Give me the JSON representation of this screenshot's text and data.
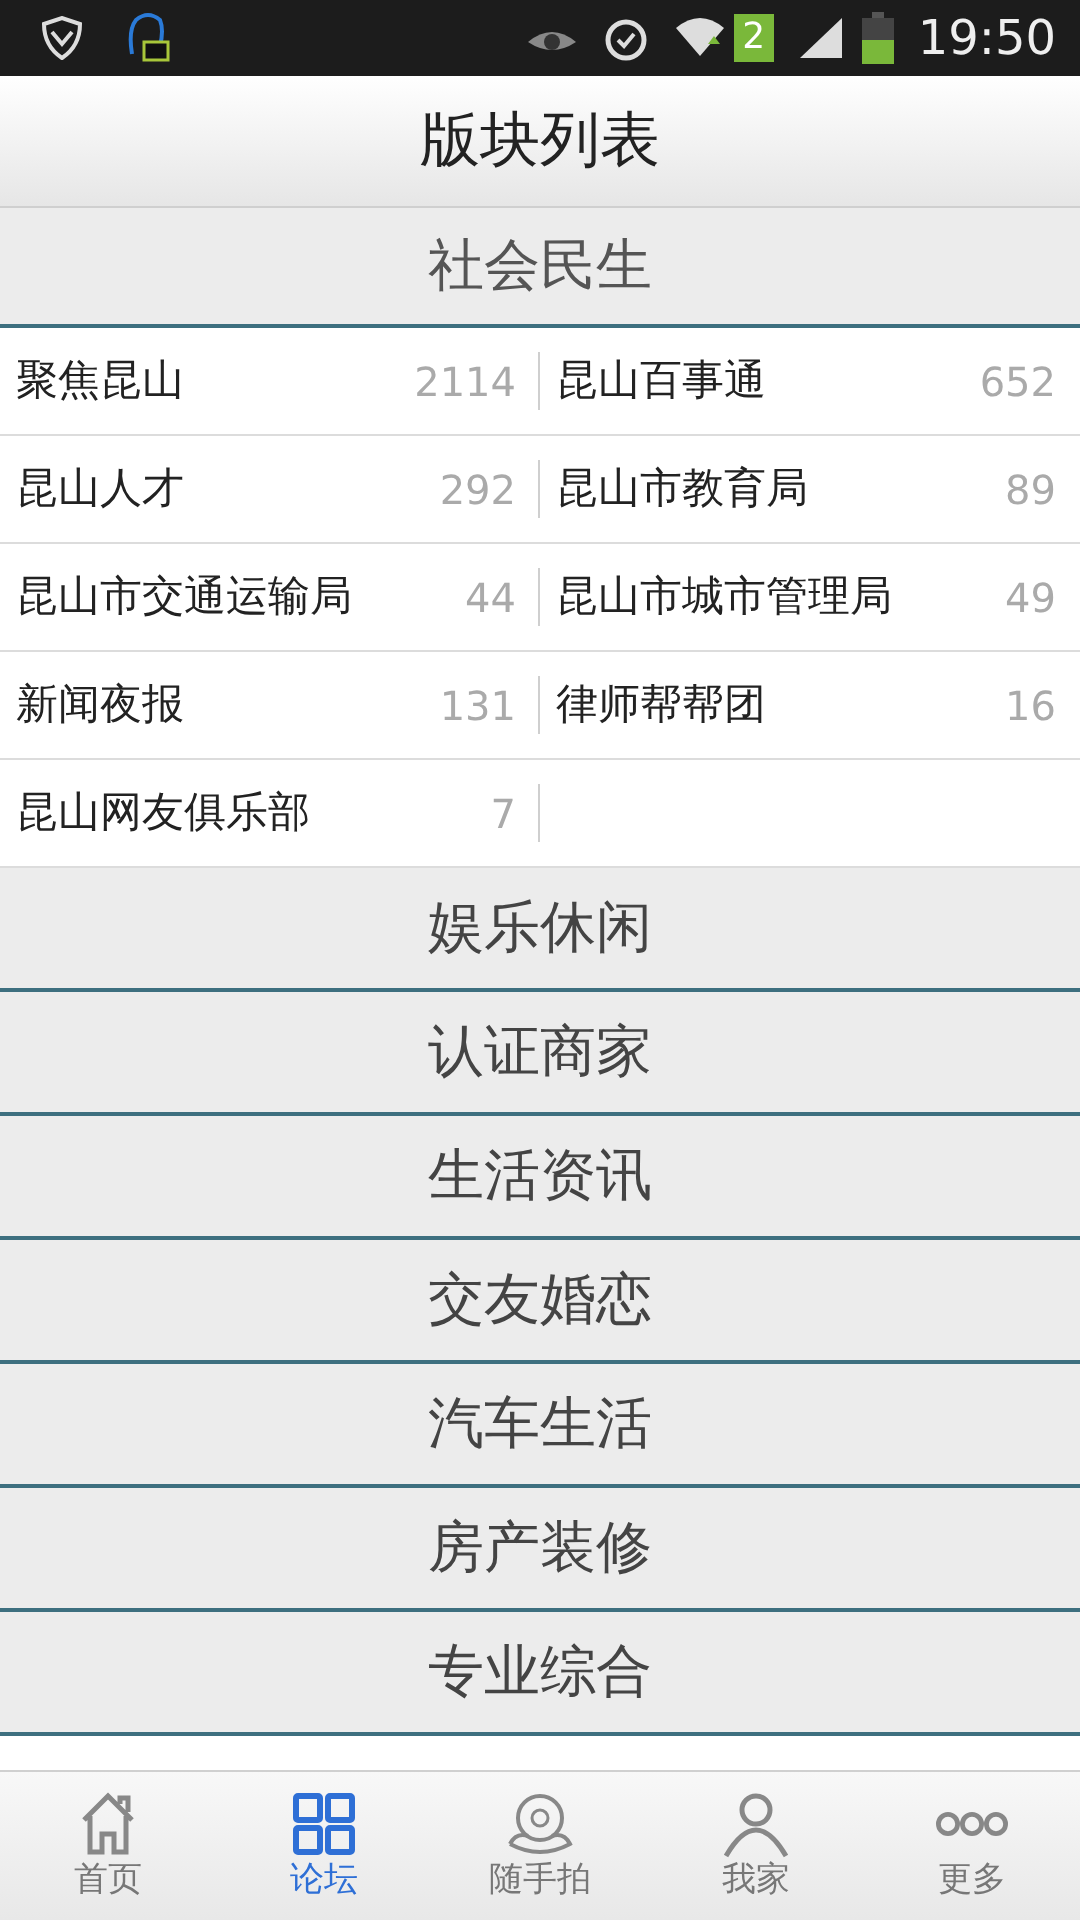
{
  "status_bar": {
    "sim_slot": "2",
    "time": "19:50"
  },
  "title": "版块列表",
  "sections": [
    {
      "title": "社会民生",
      "expanded": true,
      "forums": [
        {
          "name": "聚焦昆山",
          "count": "2114"
        },
        {
          "name": "昆山百事通",
          "count": "652"
        },
        {
          "name": "昆山人才",
          "count": "292"
        },
        {
          "name": "昆山市教育局",
          "count": "89"
        },
        {
          "name": "昆山市交通运输局",
          "count": "44"
        },
        {
          "name": "昆山市城市管理局",
          "count": "49"
        },
        {
          "name": "新闻夜报",
          "count": "131"
        },
        {
          "name": "律师帮帮团",
          "count": "16"
        },
        {
          "name": "昆山网友俱乐部",
          "count": "7"
        }
      ]
    },
    {
      "title": "娱乐休闲",
      "expanded": false
    },
    {
      "title": "认证商家",
      "expanded": false
    },
    {
      "title": "生活资讯",
      "expanded": false
    },
    {
      "title": "交友婚恋",
      "expanded": false
    },
    {
      "title": "汽车生活",
      "expanded": false
    },
    {
      "title": "房产装修",
      "expanded": false
    },
    {
      "title": "专业综合",
      "expanded": false
    }
  ],
  "tabs": [
    {
      "kind": "home",
      "label": "首页",
      "selected": false
    },
    {
      "kind": "forum",
      "label": "论坛",
      "selected": true
    },
    {
      "kind": "camera",
      "label": "随手拍",
      "selected": false
    },
    {
      "kind": "me",
      "label": "我家",
      "selected": false
    },
    {
      "kind": "more",
      "label": "更多",
      "selected": false
    }
  ]
}
